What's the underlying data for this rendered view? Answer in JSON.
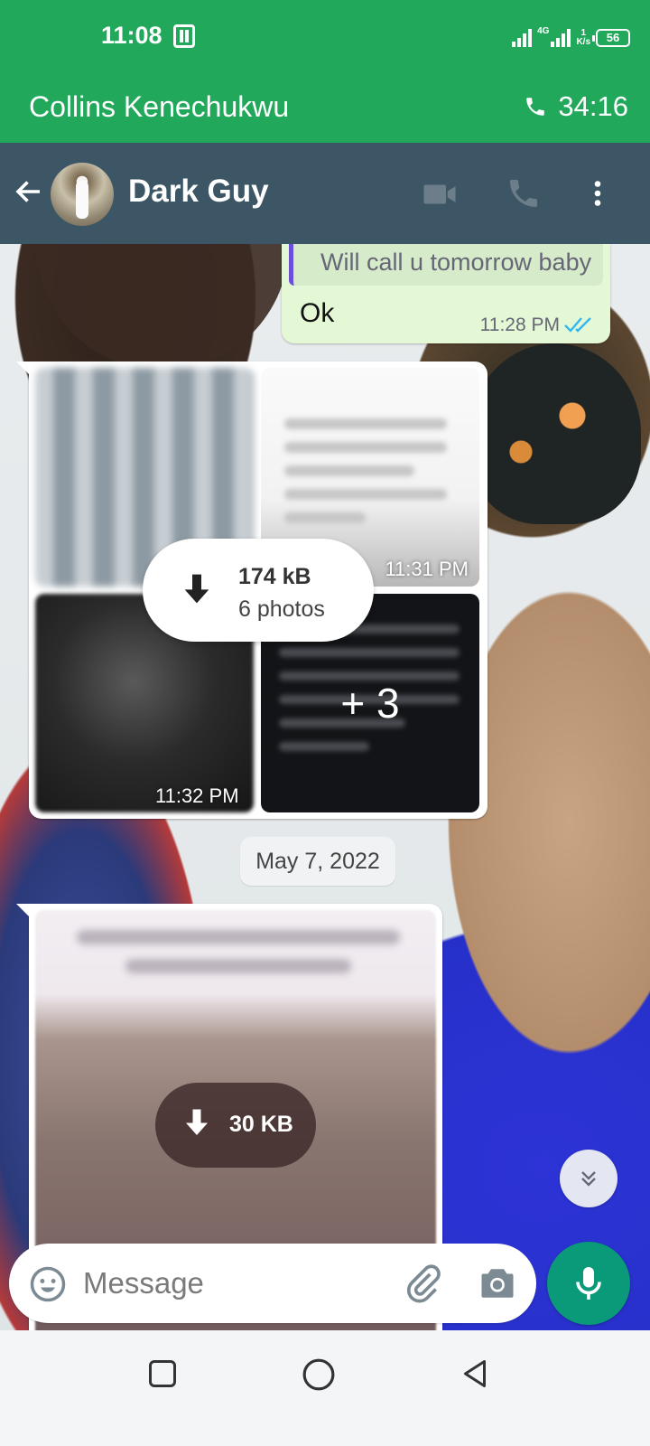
{
  "status_bar": {
    "time": "11:08",
    "network_type": "4G",
    "data_rate_value": "1",
    "data_rate_unit": "K/s",
    "battery": "56"
  },
  "call_banner": {
    "name": "Collins Kenechukwu",
    "duration": "34:16"
  },
  "chat_header": {
    "contact_name": "Dark Guy"
  },
  "messages": {
    "outgoing": {
      "quoted_text": "Will call u tomorrow baby",
      "text": "Ok",
      "time": "11:28 PM"
    },
    "album": {
      "size": "174 kB",
      "count": "6 photos",
      "time_1": "11:31 PM",
      "time_2": "11:32 PM",
      "more": "+ 3"
    },
    "date_separator": "May 7, 2022",
    "image": {
      "size": "30 KB"
    }
  },
  "input_bar": {
    "placeholder": "Message"
  },
  "colors": {
    "banner_green": "#22a85a",
    "header": "#3d5666",
    "outgoing_bubble": "#e4f8d6",
    "mic_button": "#0a9a7a",
    "read_ticks": "#34b7f1"
  }
}
